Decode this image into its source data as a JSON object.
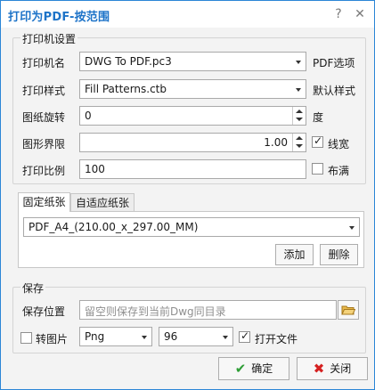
{
  "window": {
    "title": "打印为PDF-按范围",
    "help": "?",
    "close": "✕"
  },
  "printer": {
    "legend": "打印机设置",
    "name_label": "打印机名",
    "name_value": "DWG To PDF.pc3",
    "pdf_options": "PDF选项",
    "style_label": "打印样式",
    "style_value": "Fill Patterns.ctb",
    "default_style": "默认样式",
    "rotation_label": "图纸旋转",
    "rotation_value": "0",
    "degree": "度",
    "limits_label": "图形界限",
    "limits_value": "1.00",
    "lineweight": "线宽",
    "scale_label": "打印比例",
    "scale_value": "100",
    "fill": "布满",
    "lineweight_checked": true,
    "fill_checked": false
  },
  "paper": {
    "tabs": [
      {
        "label": "固定纸张",
        "active": true
      },
      {
        "label": "自适应纸张",
        "active": false
      }
    ],
    "size_value": "PDF_A4_(210.00_x_297.00_MM)",
    "add": "添加",
    "delete": "删除"
  },
  "save": {
    "legend": "保存",
    "location_label": "保存位置",
    "location_placeholder": "留空则保存到当前Dwg同目录",
    "to_image": "转图片",
    "to_image_checked": false,
    "format_value": "Png",
    "dpi_value": "96",
    "open_file": "打开文件",
    "open_file_checked": true
  },
  "actions": {
    "ok": "确定",
    "close": "关闭"
  },
  "icons": {
    "ok": "check-icon",
    "close": "x-icon",
    "folder": "folder-icon"
  },
  "colors": {
    "title": "#1d73c8",
    "border": "#2b86d6",
    "ok_icon": "#2e9e36",
    "close_icon": "#d52121"
  }
}
